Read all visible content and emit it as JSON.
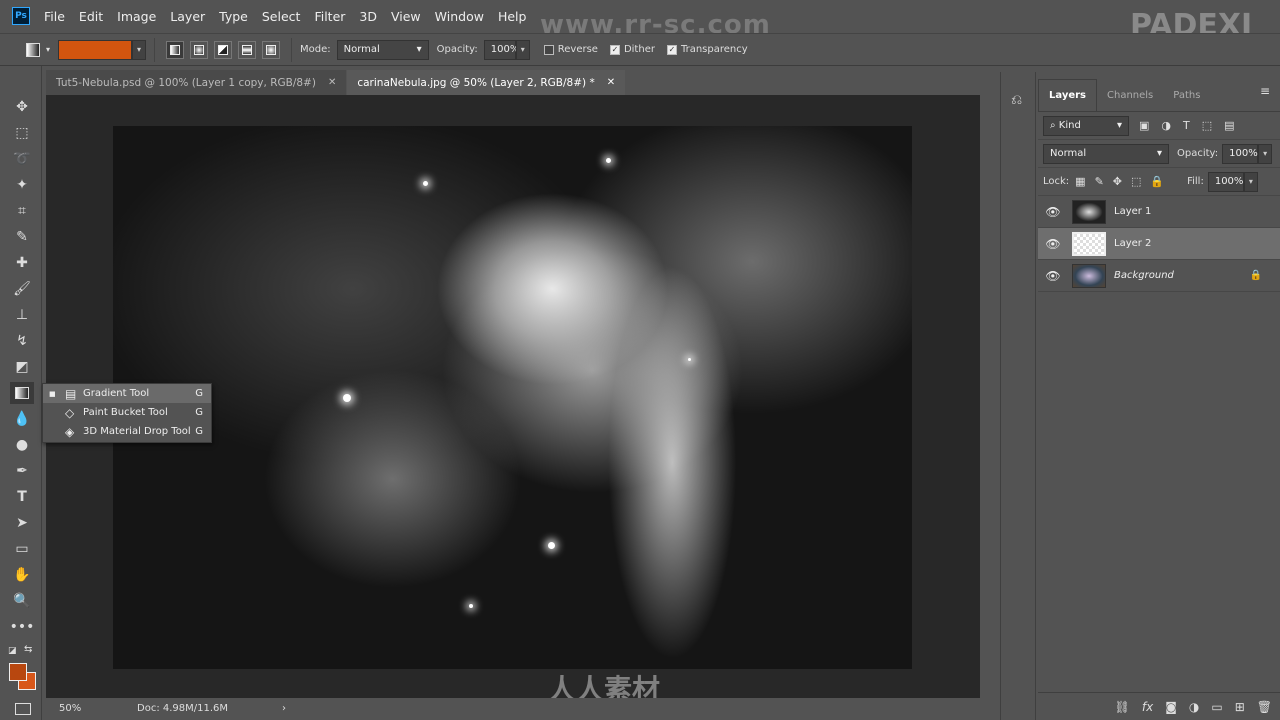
{
  "app": {
    "logo": "Ps",
    "watermark": "www.rr-sc.com",
    "brand": "PADEXI",
    "bottom_watermark": "人人素材"
  },
  "menu": [
    "File",
    "Edit",
    "Image",
    "Layer",
    "Type",
    "Select",
    "Filter",
    "3D",
    "View",
    "Window",
    "Help"
  ],
  "options": {
    "gradient_color": "#d3550f",
    "mode_label": "Mode:",
    "mode_value": "Normal",
    "opacity_label": "Opacity:",
    "opacity_value": "100%",
    "reverse": {
      "label": "Reverse",
      "checked": false
    },
    "dither": {
      "label": "Dither",
      "checked": true
    },
    "transparency": {
      "label": "Transparency",
      "checked": true
    }
  },
  "tabs": [
    {
      "label": "Tut5-Nebula.psd @ 100% (Layer 1 copy, RGB/8#)",
      "active": false
    },
    {
      "label": "carinaNebula.jpg @ 50% (Layer 2, RGB/8#) *",
      "active": true
    }
  ],
  "flyout": [
    {
      "label": "Gradient Tool",
      "shortcut": "G",
      "selected": true
    },
    {
      "label": "Paint Bucket Tool",
      "shortcut": "G",
      "selected": false
    },
    {
      "label": "3D Material Drop Tool",
      "shortcut": "G",
      "selected": false
    }
  ],
  "status": {
    "zoom": "50%",
    "doc": "Doc: 4.98M/11.6M"
  },
  "colors": {
    "foreground": "#b8470f",
    "background": "#d8571a"
  },
  "panel": {
    "tabs": [
      "Layers",
      "Channels",
      "Paths"
    ],
    "filter_kind": "Kind",
    "blend_mode": "Normal",
    "opacity_label": "Opacity:",
    "opacity_value": "100%",
    "lock_label": "Lock:",
    "fill_label": "Fill:",
    "fill_value": "100%",
    "layers": [
      {
        "name": "Layer 1",
        "selected": false,
        "locked": false
      },
      {
        "name": "Layer 2",
        "selected": true,
        "locked": false
      },
      {
        "name": "Background",
        "selected": false,
        "locked": true
      }
    ]
  }
}
